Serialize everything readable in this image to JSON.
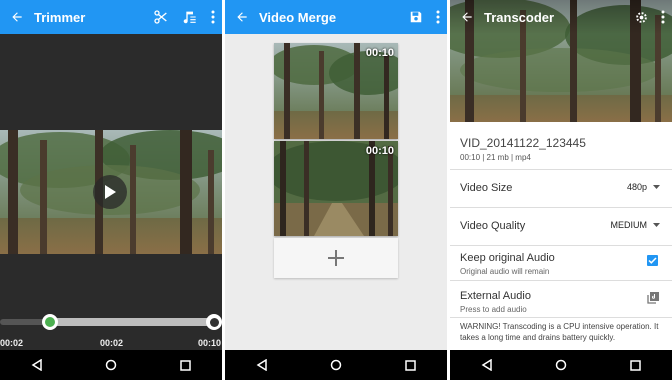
{
  "trimmer": {
    "title": "Trimmer",
    "time_start": "00:02",
    "time_current": "00:02",
    "time_end": "00:10"
  },
  "merge": {
    "title": "Video Merge",
    "clip1_duration": "00:10",
    "clip2_duration": "00:10"
  },
  "transcoder": {
    "title": "Transcoder",
    "file_name": "VID_20141122_123445",
    "file_info": "00:10 | 21 mb | mp4",
    "video_size_label": "Video Size",
    "video_size_value": "480p",
    "video_quality_label": "Video Quality",
    "video_quality_value": "MEDIUM",
    "keep_audio_label": "Keep original Audio",
    "keep_audio_sub": "Original audio will remain",
    "external_audio_label": "External Audio",
    "external_audio_sub": "Press to add audio",
    "warning": "WARNING! Transcoding is a CPU intensive operation. It takes a long time and drains battery quickly."
  },
  "colors": {
    "accent": "#2196f3",
    "seek": "#4caf50"
  },
  "icons": [
    "back-icon",
    "scissors-icon",
    "music-icon",
    "overflow-icon",
    "play-icon",
    "save-icon",
    "plus-icon",
    "gear-icon",
    "checkbox-icon",
    "add-audio-icon",
    "nav-back-icon",
    "nav-home-icon",
    "nav-recents-icon"
  ]
}
